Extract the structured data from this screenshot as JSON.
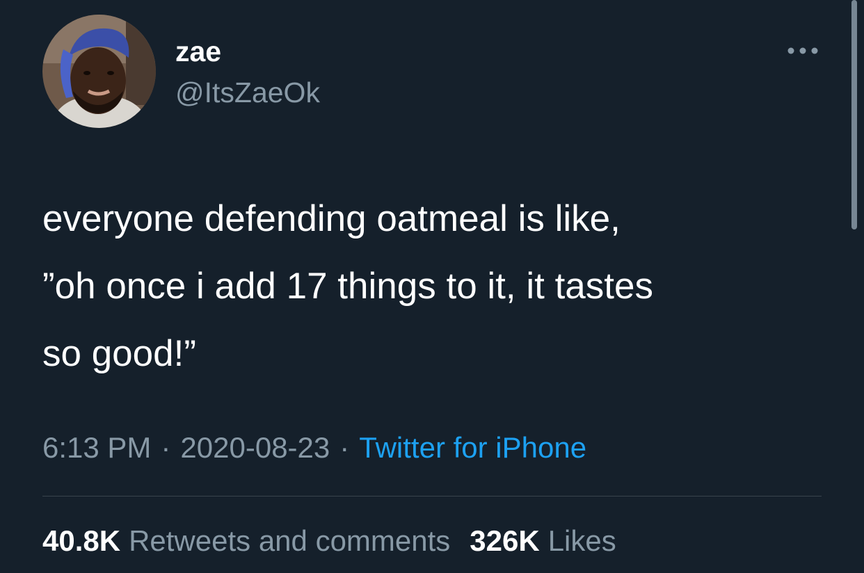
{
  "tweet": {
    "author": {
      "display_name": "zae",
      "handle": "@ItsZaeOk",
      "avatar_icon": "profile-photo"
    },
    "more_icon": "more-horizontal-icon",
    "text_lines": [
      "everyone defending oatmeal is like,",
      "”oh once i add 17 things to it, it tastes",
      "so good!”"
    ],
    "time": "6:13 PM",
    "separator": "·",
    "date": "2020-08-23",
    "source": "Twitter for iPhone",
    "stats": {
      "retweets_count": "40.8K",
      "retweets_label": "Retweets and comments",
      "likes_count": "326K",
      "likes_label": "Likes"
    }
  },
  "colors": {
    "background": "#15202b",
    "primary_text": "#ffffff",
    "secondary_text": "#8899a6",
    "link": "#1da1f2",
    "divider": "#38444d"
  }
}
